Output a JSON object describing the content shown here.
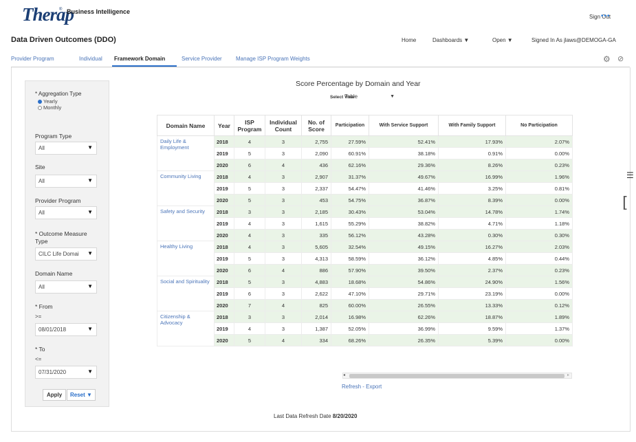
{
  "header": {
    "logo": "Therap",
    "logo_mark": "®",
    "product": "Business Intelligence",
    "sign_out": "Sign Out",
    "more": "•••"
  },
  "page_title": "Data Driven Outcomes (DDO)",
  "nav": {
    "home": "Home",
    "dashboards": "Dashboards ▼",
    "open": "Open ▼",
    "signed_in": "Signed In As  jlaws@DEMOGA-GA"
  },
  "tabs": [
    "Provider Program",
    "Individual",
    "Framework Domain",
    "Service Provider",
    "Manage ISP Program Weights"
  ],
  "filters": {
    "aggregation_label": "* Aggregation Type",
    "yearly": "Yearly",
    "monthly": "Monthly",
    "program_type_label": "Program Type",
    "program_type_value": "All",
    "site_label": "Site",
    "site_value": "All",
    "provider_program_label": "Provider Program",
    "provider_program_value": "All",
    "outcome_label_1": "* Outcome Measure",
    "outcome_label_2": "Type",
    "outcome_value": "CILC Life Domai",
    "domain_label": "Domain Name",
    "domain_value": "All",
    "from_label": "* From",
    "from_op": ">=",
    "from_value": "08/01/2018",
    "to_label": "* To",
    "to_op": "<=",
    "to_value": "07/31/2020",
    "apply": "Apply",
    "reset": "Reset ▼"
  },
  "report": {
    "title": "Score Percentage by Domain and Year",
    "select_view_label": "Select View",
    "select_view_value": "Table",
    "columns": [
      "Domain Name",
      "Year",
      "ISP Program",
      "Individual Count",
      "No. of Score",
      "Participation",
      "With Service Support",
      "With Family Support",
      "No Participation"
    ],
    "domains": [
      {
        "name": "Daily Life & Employment",
        "rows": [
          [
            "2018",
            "4",
            "3",
            "2,755",
            "27.59%",
            "52.41%",
            "17.93%",
            "2.07%"
          ],
          [
            "2019",
            "5",
            "3",
            "2,090",
            "60.91%",
            "38.18%",
            "0.91%",
            "0.00%"
          ],
          [
            "2020",
            "6",
            "4",
            "436",
            "62.16%",
            "29.36%",
            "8.26%",
            "0.23%"
          ]
        ]
      },
      {
        "name": "Community Living",
        "rows": [
          [
            "2018",
            "4",
            "3",
            "2,907",
            "31.37%",
            "49.67%",
            "16.99%",
            "1.96%"
          ],
          [
            "2019",
            "5",
            "3",
            "2,337",
            "54.47%",
            "41.46%",
            "3.25%",
            "0.81%"
          ],
          [
            "2020",
            "5",
            "3",
            "453",
            "54.75%",
            "36.87%",
            "8.39%",
            "0.00%"
          ]
        ]
      },
      {
        "name": "Safety and Security",
        "rows": [
          [
            "2018",
            "3",
            "3",
            "2,185",
            "30.43%",
            "53.04%",
            "14.78%",
            "1.74%"
          ],
          [
            "2019",
            "4",
            "3",
            "1,615",
            "55.29%",
            "38.82%",
            "4.71%",
            "1.18%"
          ],
          [
            "2020",
            "4",
            "3",
            "335",
            "56.12%",
            "43.28%",
            "0.30%",
            "0.30%"
          ]
        ]
      },
      {
        "name": "Healthy Living",
        "rows": [
          [
            "2018",
            "4",
            "3",
            "5,605",
            "32.54%",
            "49.15%",
            "16.27%",
            "2.03%"
          ],
          [
            "2019",
            "5",
            "3",
            "4,313",
            "58.59%",
            "36.12%",
            "4.85%",
            "0.44%"
          ],
          [
            "2020",
            "6",
            "4",
            "886",
            "57.90%",
            "39.50%",
            "2.37%",
            "0.23%"
          ]
        ]
      },
      {
        "name": "Social and Spirituality",
        "rows": [
          [
            "2018",
            "5",
            "3",
            "4,883",
            "18.68%",
            "54.86%",
            "24.90%",
            "1.56%"
          ],
          [
            "2019",
            "6",
            "3",
            "2,622",
            "47.10%",
            "29.71%",
            "23.19%",
            "0.00%"
          ],
          [
            "2020",
            "7",
            "4",
            "825",
            "60.00%",
            "26.55%",
            "13.33%",
            "0.12%"
          ]
        ]
      },
      {
        "name": "Citizenship & Advocacy",
        "rows": [
          [
            "2018",
            "3",
            "3",
            "2,014",
            "16.98%",
            "62.26%",
            "18.87%",
            "1.89%"
          ],
          [
            "2019",
            "4",
            "3",
            "1,387",
            "52.05%",
            "36.99%",
            "9.59%",
            "1.37%"
          ],
          [
            "2020",
            "5",
            "4",
            "334",
            "68.26%",
            "26.35%",
            "5.39%",
            "0.00%"
          ]
        ]
      }
    ],
    "links": "Refresh - Export",
    "last_refresh_label": "Last Data Refresh Date",
    "last_refresh_value": "8/20/2020"
  }
}
